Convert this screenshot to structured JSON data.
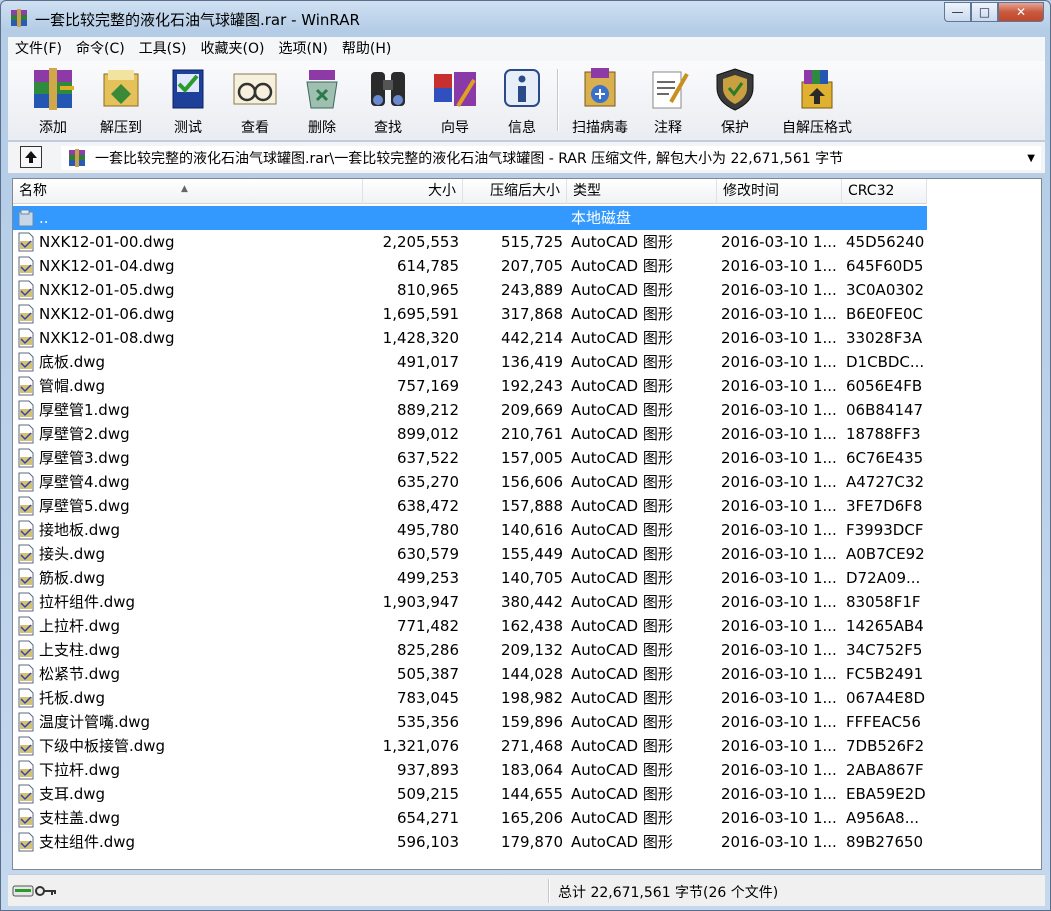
{
  "window": {
    "title": "一套比较完整的液化石油气球罐图.rar - WinRAR",
    "minimize": "—",
    "maximize": "□",
    "close": "✕"
  },
  "menu": [
    "文件(F)",
    "命令(C)",
    "工具(S)",
    "收藏夹(O)",
    "选项(N)",
    "帮助(H)"
  ],
  "toolbar": [
    {
      "label": "添加",
      "icon": "add-archive-icon"
    },
    {
      "label": "解压到",
      "icon": "extract-to-icon"
    },
    {
      "label": "测试",
      "icon": "test-icon"
    },
    {
      "label": "查看",
      "icon": "view-icon"
    },
    {
      "label": "删除",
      "icon": "delete-icon"
    },
    {
      "label": "查找",
      "icon": "find-icon"
    },
    {
      "label": "向导",
      "icon": "wizard-icon"
    },
    {
      "label": "信息",
      "icon": "info-icon"
    },
    {
      "label": "扫描病毒",
      "icon": "virus-scan-icon"
    },
    {
      "label": "注释",
      "icon": "comment-icon"
    },
    {
      "label": "保护",
      "icon": "protect-icon"
    },
    {
      "label": "自解压格式",
      "icon": "sfx-icon"
    }
  ],
  "address": {
    "path": "一套比较完整的液化石油气球罐图.rar\\一套比较完整的液化石油气球罐图 - RAR 压缩文件, 解包大小为 22,671,561 字节"
  },
  "columns": {
    "name": "名称",
    "size": "大小",
    "packed": "压缩后大小",
    "type": "类型",
    "modified": "修改时间",
    "crc": "CRC32"
  },
  "parent_row": {
    "name": "..",
    "type": "本地磁盘"
  },
  "files": [
    {
      "name": "NXK12-01-00.dwg",
      "size": "2,205,553",
      "packed": "515,725",
      "type": "AutoCAD 图形",
      "modified": "2016-03-10 1...",
      "crc": "45D56240"
    },
    {
      "name": "NXK12-01-04.dwg",
      "size": "614,785",
      "packed": "207,705",
      "type": "AutoCAD 图形",
      "modified": "2016-03-10 1...",
      "crc": "645F60D5"
    },
    {
      "name": "NXK12-01-05.dwg",
      "size": "810,965",
      "packed": "243,889",
      "type": "AutoCAD 图形",
      "modified": "2016-03-10 1...",
      "crc": "3C0A0302"
    },
    {
      "name": "NXK12-01-06.dwg",
      "size": "1,695,591",
      "packed": "317,868",
      "type": "AutoCAD 图形",
      "modified": "2016-03-10 1...",
      "crc": "B6E0FE0C"
    },
    {
      "name": "NXK12-01-08.dwg",
      "size": "1,428,320",
      "packed": "442,214",
      "type": "AutoCAD 图形",
      "modified": "2016-03-10 1...",
      "crc": "33028F3A"
    },
    {
      "name": "底板.dwg",
      "size": "491,017",
      "packed": "136,419",
      "type": "AutoCAD 图形",
      "modified": "2016-03-10 1...",
      "crc": "D1CBDC..."
    },
    {
      "name": "管帽.dwg",
      "size": "757,169",
      "packed": "192,243",
      "type": "AutoCAD 图形",
      "modified": "2016-03-10 1...",
      "crc": "6056E4FB"
    },
    {
      "name": "厚壁管1.dwg",
      "size": "889,212",
      "packed": "209,669",
      "type": "AutoCAD 图形",
      "modified": "2016-03-10 1...",
      "crc": "06B84147"
    },
    {
      "name": "厚壁管2.dwg",
      "size": "899,012",
      "packed": "210,761",
      "type": "AutoCAD 图形",
      "modified": "2016-03-10 1...",
      "crc": "18788FF3"
    },
    {
      "name": "厚壁管3.dwg",
      "size": "637,522",
      "packed": "157,005",
      "type": "AutoCAD 图形",
      "modified": "2016-03-10 1...",
      "crc": "6C76E435"
    },
    {
      "name": "厚壁管4.dwg",
      "size": "635,270",
      "packed": "156,606",
      "type": "AutoCAD 图形",
      "modified": "2016-03-10 1...",
      "crc": "A4727C32"
    },
    {
      "name": "厚壁管5.dwg",
      "size": "638,472",
      "packed": "157,888",
      "type": "AutoCAD 图形",
      "modified": "2016-03-10 1...",
      "crc": "3FE7D6F8"
    },
    {
      "name": "接地板.dwg",
      "size": "495,780",
      "packed": "140,616",
      "type": "AutoCAD 图形",
      "modified": "2016-03-10 1...",
      "crc": "F3993DCF"
    },
    {
      "name": "接头.dwg",
      "size": "630,579",
      "packed": "155,449",
      "type": "AutoCAD 图形",
      "modified": "2016-03-10 1...",
      "crc": "A0B7CE92"
    },
    {
      "name": "筋板.dwg",
      "size": "499,253",
      "packed": "140,705",
      "type": "AutoCAD 图形",
      "modified": "2016-03-10 1...",
      "crc": "D72A09..."
    },
    {
      "name": "拉杆组件.dwg",
      "size": "1,903,947",
      "packed": "380,442",
      "type": "AutoCAD 图形",
      "modified": "2016-03-10 1...",
      "crc": "83058F1F"
    },
    {
      "name": "上拉杆.dwg",
      "size": "771,482",
      "packed": "162,438",
      "type": "AutoCAD 图形",
      "modified": "2016-03-10 1...",
      "crc": "14265AB4"
    },
    {
      "name": "上支柱.dwg",
      "size": "825,286",
      "packed": "209,132",
      "type": "AutoCAD 图形",
      "modified": "2016-03-10 1...",
      "crc": "34C752F5"
    },
    {
      "name": "松紧节.dwg",
      "size": "505,387",
      "packed": "144,028",
      "type": "AutoCAD 图形",
      "modified": "2016-03-10 1...",
      "crc": "FC5B2491"
    },
    {
      "name": "托板.dwg",
      "size": "783,045",
      "packed": "198,982",
      "type": "AutoCAD 图形",
      "modified": "2016-03-10 1...",
      "crc": "067A4E8D"
    },
    {
      "name": "温度计管嘴.dwg",
      "size": "535,356",
      "packed": "159,896",
      "type": "AutoCAD 图形",
      "modified": "2016-03-10 1...",
      "crc": "FFFEAC56"
    },
    {
      "name": "下级中板接管.dwg",
      "size": "1,321,076",
      "packed": "271,468",
      "type": "AutoCAD 图形",
      "modified": "2016-03-10 1...",
      "crc": "7DB526F2"
    },
    {
      "name": "下拉杆.dwg",
      "size": "937,893",
      "packed": "183,064",
      "type": "AutoCAD 图形",
      "modified": "2016-03-10 1...",
      "crc": "2ABA867F"
    },
    {
      "name": "支耳.dwg",
      "size": "509,215",
      "packed": "144,655",
      "type": "AutoCAD 图形",
      "modified": "2016-03-10 1...",
      "crc": "EBA59E2D"
    },
    {
      "name": "支柱盖.dwg",
      "size": "654,271",
      "packed": "165,206",
      "type": "AutoCAD 图形",
      "modified": "2016-03-10 1...",
      "crc": "A956A8..."
    },
    {
      "name": "支柱组件.dwg",
      "size": "596,103",
      "packed": "179,870",
      "type": "AutoCAD 图形",
      "modified": "2016-03-10 1...",
      "crc": "89B27650"
    }
  ],
  "status": {
    "total": "总计 22,671,561 字节(26 个文件)"
  }
}
